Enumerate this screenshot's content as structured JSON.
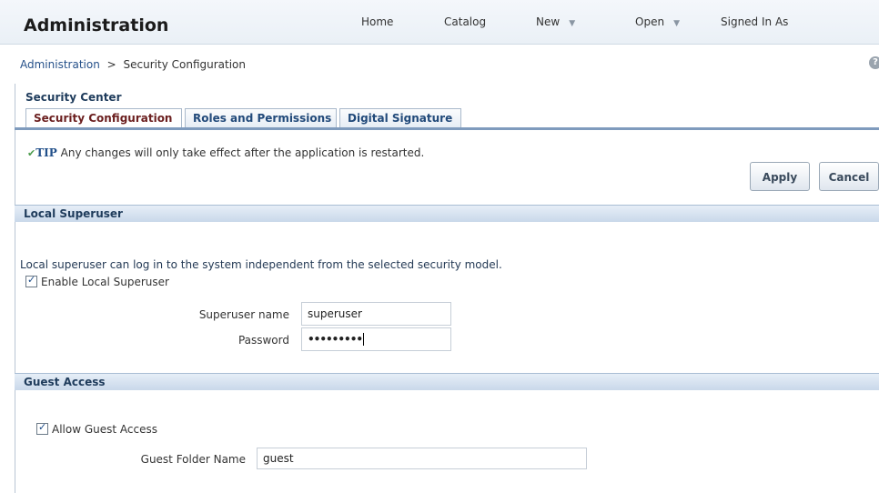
{
  "header": {
    "title": "Administration",
    "nav": [
      {
        "label": "Home",
        "has_menu": false
      },
      {
        "label": "Catalog",
        "has_menu": false
      },
      {
        "label": "New",
        "has_menu": true
      },
      {
        "label": "Open",
        "has_menu": true
      },
      {
        "label": "Signed In As",
        "has_menu": false
      }
    ]
  },
  "breadcrumb": {
    "root": "Administration",
    "separator": ">",
    "current": "Security Configuration"
  },
  "help_icon": "help-icon",
  "security_center": {
    "title": "Security Center",
    "tabs": [
      {
        "label": "Security Configuration",
        "active": true
      },
      {
        "label": "Roles and Permissions",
        "active": false
      },
      {
        "label": "Digital Signature",
        "active": false
      }
    ]
  },
  "tip": {
    "label": "TIP",
    "text": "Any changes will only take effect after the application is restarted."
  },
  "buttons": {
    "apply": "Apply",
    "cancel": "Cancel"
  },
  "local_superuser": {
    "heading": "Local Superuser",
    "description": "Local superuser can log in to the system independent from the selected security model.",
    "enable_label": "Enable Local Superuser",
    "enable_checked": true,
    "name_label": "Superuser name",
    "name_value": "superuser",
    "password_label": "Password",
    "password_value": "•••••••••"
  },
  "guest_access": {
    "heading": "Guest Access",
    "allow_label": "Allow Guest Access",
    "allow_checked": true,
    "folder_label": "Guest Folder Name",
    "folder_value": "guest"
  },
  "colors": {
    "header_bg": "#eaf0f6",
    "link": "#26518a",
    "active_tab": "#6b1f1f",
    "band": "#c9d8ea"
  }
}
